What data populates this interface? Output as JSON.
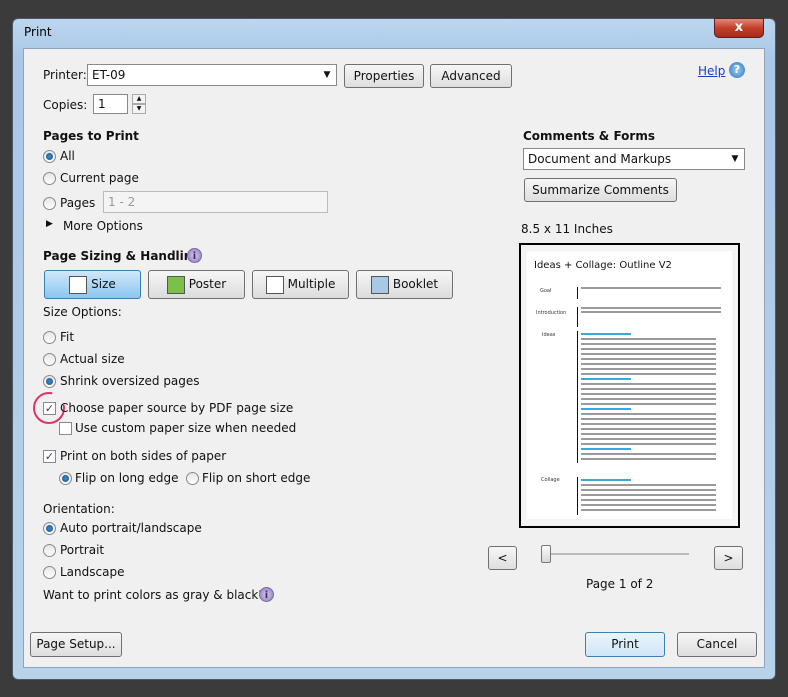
{
  "window": {
    "title": "Print",
    "close": "x"
  },
  "printer": {
    "label": "Printer:",
    "value": "ET-09",
    "properties": "Properties",
    "advanced": "Advanced",
    "help": "Help"
  },
  "copies": {
    "label": "Copies:",
    "value": "1"
  },
  "pages_to_print": {
    "heading": "Pages to Print",
    "all": "All",
    "current": "Current page",
    "pages": "Pages",
    "pages_value": "1 - 2",
    "more": "More Options"
  },
  "sizing": {
    "heading": "Page Sizing & Handling",
    "tabs": [
      "Size",
      "Poster",
      "Multiple",
      "Booklet"
    ],
    "size_options": "Size Options:",
    "fit": "Fit",
    "actual": "Actual size",
    "shrink": "Shrink oversized pages",
    "choose_source": "Choose paper source by PDF page size",
    "custom_size": "Use custom paper size when needed",
    "both_sides": "Print on both sides of paper",
    "long_edge": "Flip on long edge",
    "short_edge": "Flip on short edge"
  },
  "orientation": {
    "heading": "Orientation:",
    "auto": "Auto portrait/landscape",
    "portrait": "Portrait",
    "landscape": "Landscape",
    "gray": "Want to print colors as gray & black?"
  },
  "comments": {
    "heading": "Comments & Forms",
    "value": "Document and Markups",
    "summarize": "Summarize Comments"
  },
  "preview": {
    "size": "8.5 x 11 Inches",
    "doc_title": "Ideas + Collage: Outline V2",
    "sections": [
      "Goal",
      "Introduction",
      "Ideas",
      "Collage"
    ],
    "page_label": "Page 1 of 2",
    "prev": "<",
    "next": ">",
    "slider_value": 0
  },
  "footer": {
    "page_setup": "Page Setup...",
    "print": "Print",
    "cancel": "Cancel"
  },
  "colors": {
    "accent": "#3c7fb1",
    "highlight_circle": "#e0336a"
  }
}
